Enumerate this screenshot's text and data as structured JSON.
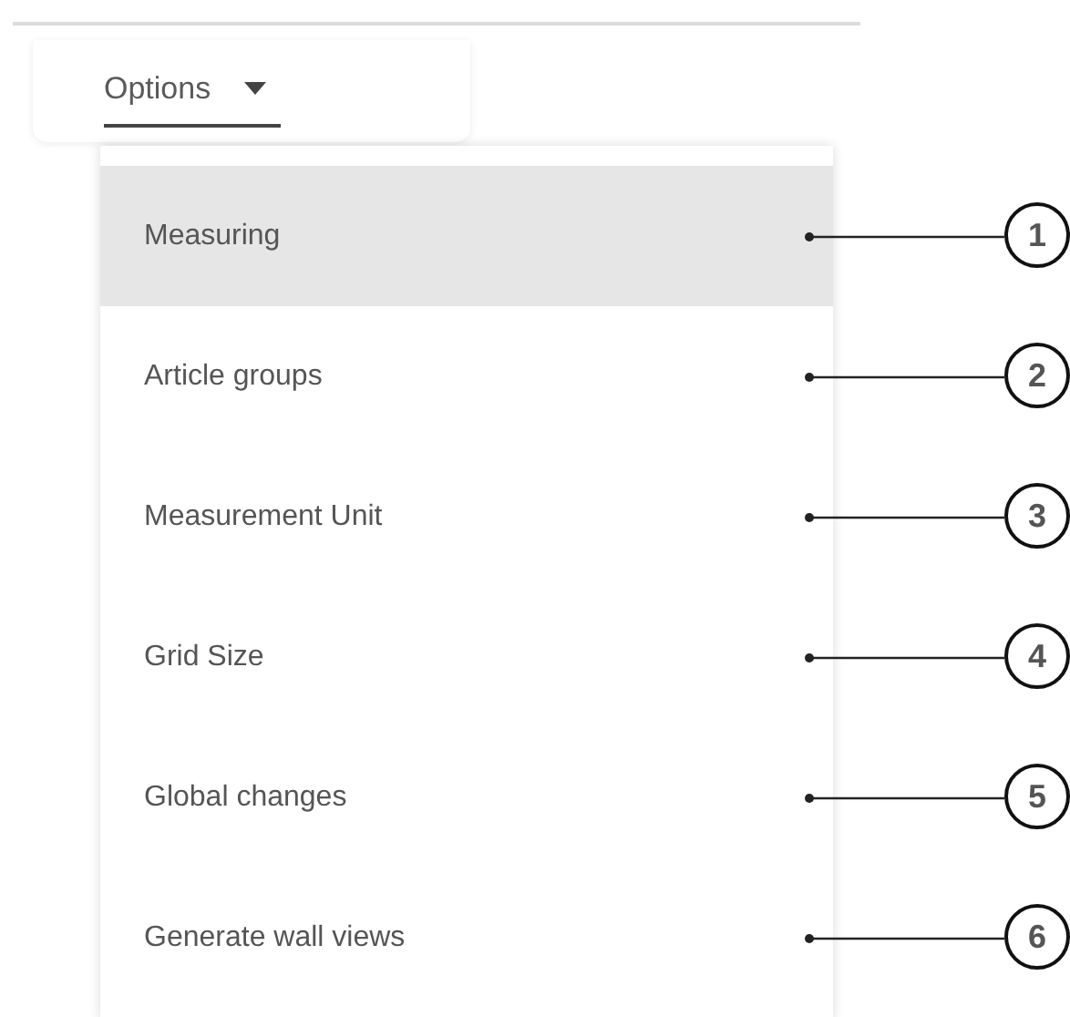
{
  "options_tab": {
    "label": "Options",
    "expanded": true
  },
  "menu": {
    "items": [
      {
        "label": "Measuring",
        "selected": true,
        "callout": "1"
      },
      {
        "label": "Article groups",
        "selected": false,
        "callout": "2"
      },
      {
        "label": "Measurement Unit",
        "selected": false,
        "callout": "3"
      },
      {
        "label": "Grid Size",
        "selected": false,
        "callout": "4"
      },
      {
        "label": "Global changes",
        "selected": false,
        "callout": "5"
      },
      {
        "label": "Generate wall views",
        "selected": false,
        "callout": "6"
      }
    ]
  }
}
